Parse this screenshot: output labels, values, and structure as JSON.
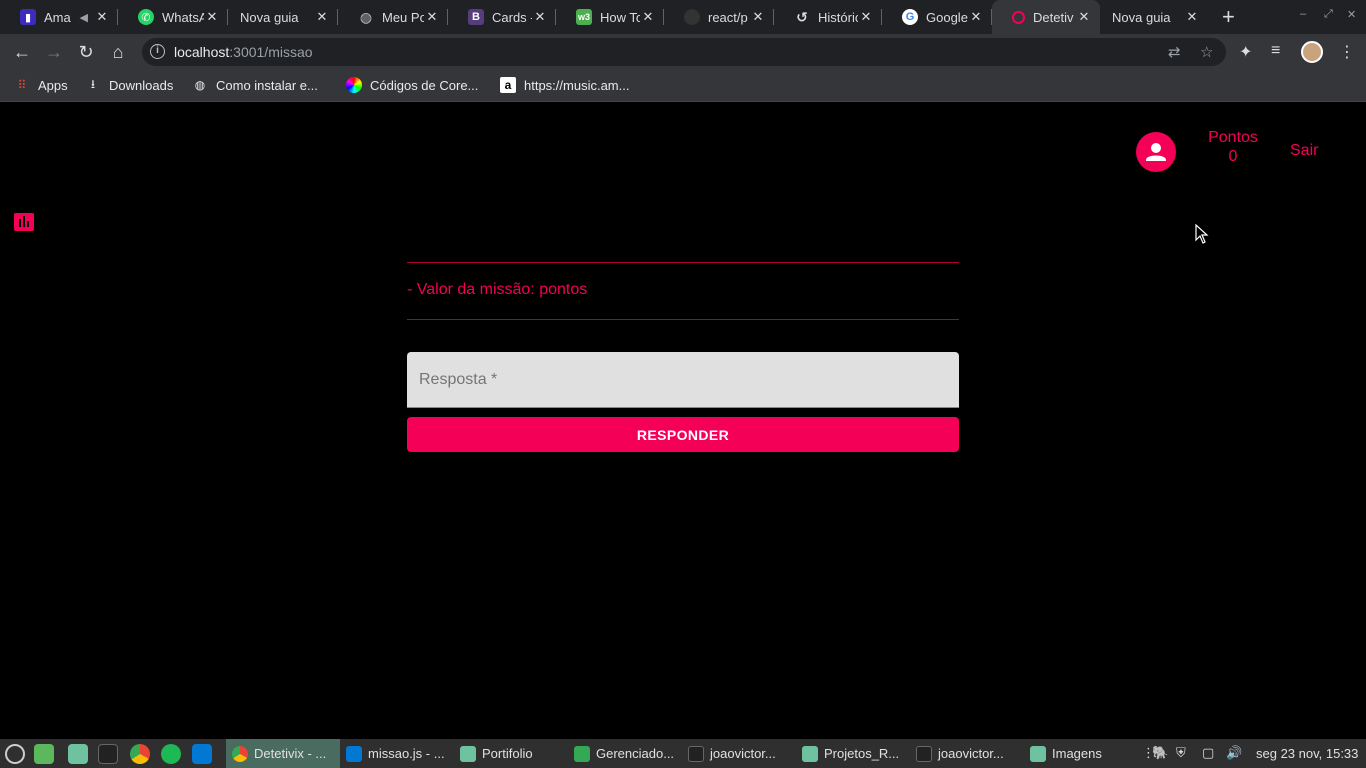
{
  "browser": {
    "tabs": [
      {
        "title": "Ama",
        "icon": "amazon-music-icon",
        "color": "#3c2bbf"
      },
      {
        "title": "WhatsA",
        "icon": "whatsapp-icon",
        "color": "#25d366"
      },
      {
        "title": "Nova guia",
        "icon": "",
        "color": ""
      },
      {
        "title": "Meu Po",
        "icon": "globe-icon",
        "color": "#bdc1c6"
      },
      {
        "title": "Cards -",
        "icon": "bootstrap-icon",
        "color": "#563d7c"
      },
      {
        "title": "How To",
        "icon": "w3schools-icon",
        "color": "#4caf50"
      },
      {
        "title": "react/p",
        "icon": "github-icon",
        "color": "#333333"
      },
      {
        "title": "Históric",
        "icon": "history-icon",
        "color": "#dadce0"
      },
      {
        "title": "Google",
        "icon": "google-icon",
        "color": "#4285f4"
      },
      {
        "title": "Detetiv",
        "icon": "detetivix-icon",
        "color": "#f50057"
      },
      {
        "title": "Nova guia",
        "icon": "",
        "color": ""
      }
    ],
    "active_tab_index": 9,
    "url_host": "localhost",
    "url_path": ":3001/missao",
    "bookmarks": [
      {
        "label": "Apps",
        "icon": "apps-grid-icon"
      },
      {
        "label": "Downloads",
        "icon": "download-icon"
      },
      {
        "label": "Como instalar e...",
        "icon": "globe-icon"
      },
      {
        "label": "Códigos de Core...",
        "icon": "color-wheel-icon"
      },
      {
        "label": "https://music.am...",
        "icon": "amazon-icon"
      }
    ]
  },
  "header": {
    "points_label": "Pontos",
    "points_value": "0",
    "logout_label": "Sair"
  },
  "mission": {
    "value_text": "- Valor da missão: pontos",
    "answer_placeholder": "Resposta *",
    "submit_label": "RESPONDER"
  },
  "taskbar": {
    "windows": [
      {
        "label": "Detetivix - ...",
        "icon": "chrome-icon"
      },
      {
        "label": "missao.js - ...",
        "icon": "vscode-icon"
      },
      {
        "label": "Portifolio",
        "icon": "folder-icon"
      },
      {
        "label": "Gerenciado...",
        "icon": "shield-icon"
      },
      {
        "label": "joaovictor...",
        "icon": "terminal-icon"
      },
      {
        "label": "Projetos_R...",
        "icon": "folder-icon"
      },
      {
        "label": "joaovictor...",
        "icon": "terminal-icon"
      },
      {
        "label": "Imagens",
        "icon": "folder-icon"
      }
    ],
    "clock": "seg 23 nov, 15:33"
  },
  "colors": {
    "accent": "#f50057",
    "background": "#000000",
    "input_bg": "#e0e0e0"
  }
}
